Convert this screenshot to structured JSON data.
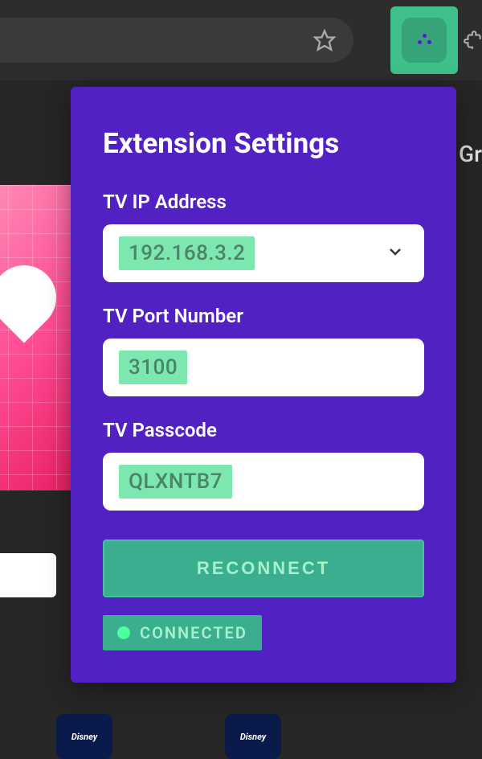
{
  "toolbar": {
    "bookmark_icon": "star-icon",
    "extension_icon": "extension-icon",
    "extensions_menu_icon": "puzzle-icon"
  },
  "background": {
    "partial_text": "Gr",
    "app_tiles": [
      "Disney",
      "Disney"
    ]
  },
  "popup": {
    "title": "Extension Settings",
    "fields": {
      "ip": {
        "label": "TV IP Address",
        "value": "192.168.3.2",
        "has_dropdown": true
      },
      "port": {
        "label": "TV Port Number",
        "value": "3100"
      },
      "passcode": {
        "label": "TV Passcode",
        "value": "QLXNTB7"
      }
    },
    "reconnect_label": "RECONNECT",
    "status": {
      "text": "CONNECTED",
      "color": "#4dff9d"
    }
  }
}
